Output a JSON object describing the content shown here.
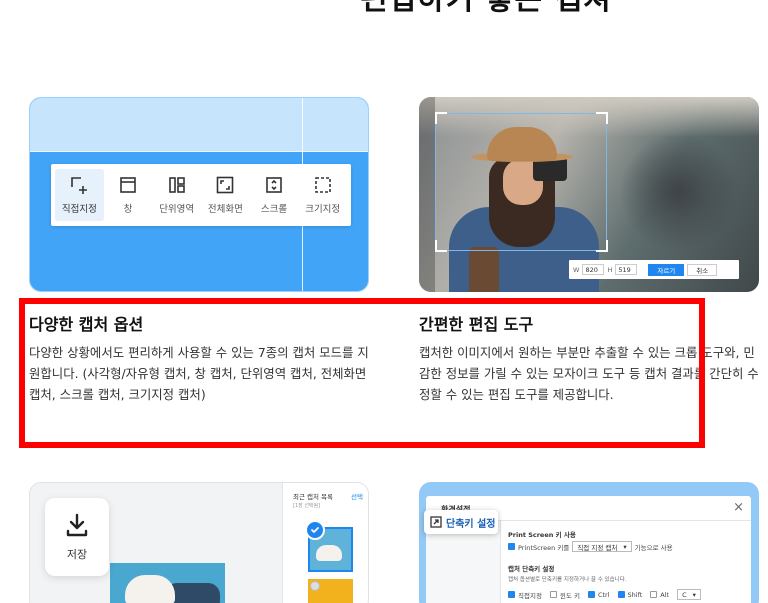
{
  "page": {
    "top_heading": "편집하기 좋은 캡쳐"
  },
  "features": [
    {
      "title": "다양한 캡처 옵션",
      "description": "다양한 상황에서도 편리하게 사용할 수 있는 7종의 캡처 모드를 지원합니다. (사각형/자유형 캡처, 창 캡처, 단위영역 캡처, 전체화면 캡처, 스크롤 캡처, 크기지정 캡처)"
    },
    {
      "title": "간편한 편집 도구",
      "description": "캡처한 이미지에서 원하는 부분만 추출할 수 있는 크롭 도구와, 민감한 정보를 가릴 수 있는 모자이크 도구 등 캡처 결과를 간단히 수정할 수 있는 편집 도구를 제공합니다."
    }
  ],
  "capture_toolbar": {
    "items": [
      {
        "label": "직접지정",
        "icon": "direct-select-icon",
        "active": true
      },
      {
        "label": "창",
        "icon": "window-icon",
        "active": false
      },
      {
        "label": "단위영역",
        "icon": "unit-area-icon",
        "active": false
      },
      {
        "label": "전체화면",
        "icon": "fullscreen-icon",
        "active": false
      },
      {
        "label": "스크롤",
        "icon": "scroll-icon",
        "active": false
      },
      {
        "label": "크기지정",
        "icon": "size-select-icon",
        "active": false
      }
    ]
  },
  "edit_bar": {
    "w_label": "W",
    "w_value": "820",
    "h_label": "H",
    "h_value": "519",
    "crop_label": "자르기",
    "cancel_label": "취소"
  },
  "save_card": {
    "save_label": "저장",
    "recent_title": "최근 캡처 목록",
    "recent_subtitle": "[1장 선택됨]",
    "select_label": "선택"
  },
  "settings_card": {
    "window_title": "환경설정",
    "close_glyph": "×",
    "shortcut_tab": "단축키 설정",
    "section1_title": "Print Screen 키 사용",
    "row1_prefix": "PrintScreen 키를",
    "row1_select": "직접 지정 캡처",
    "row1_suffix": "기능으로 사용",
    "section2_title": "캡처 단축키 설정",
    "section2_hint": "캡처 옵션별로 단축키를 지정하거나 끌 수 있습니다.",
    "row2_items": [
      {
        "label": "직접지정",
        "checked": true
      },
      {
        "label": "윈도 키",
        "checked": false
      },
      {
        "label": "Ctrl",
        "checked": true
      },
      {
        "label": "Shift",
        "checked": true
      },
      {
        "label": "Alt",
        "checked": false
      }
    ],
    "row2_key": "C"
  },
  "colors": {
    "accent": "#1f86f0",
    "highlight": "#ff0000",
    "card_blue": "#41a4f7"
  }
}
